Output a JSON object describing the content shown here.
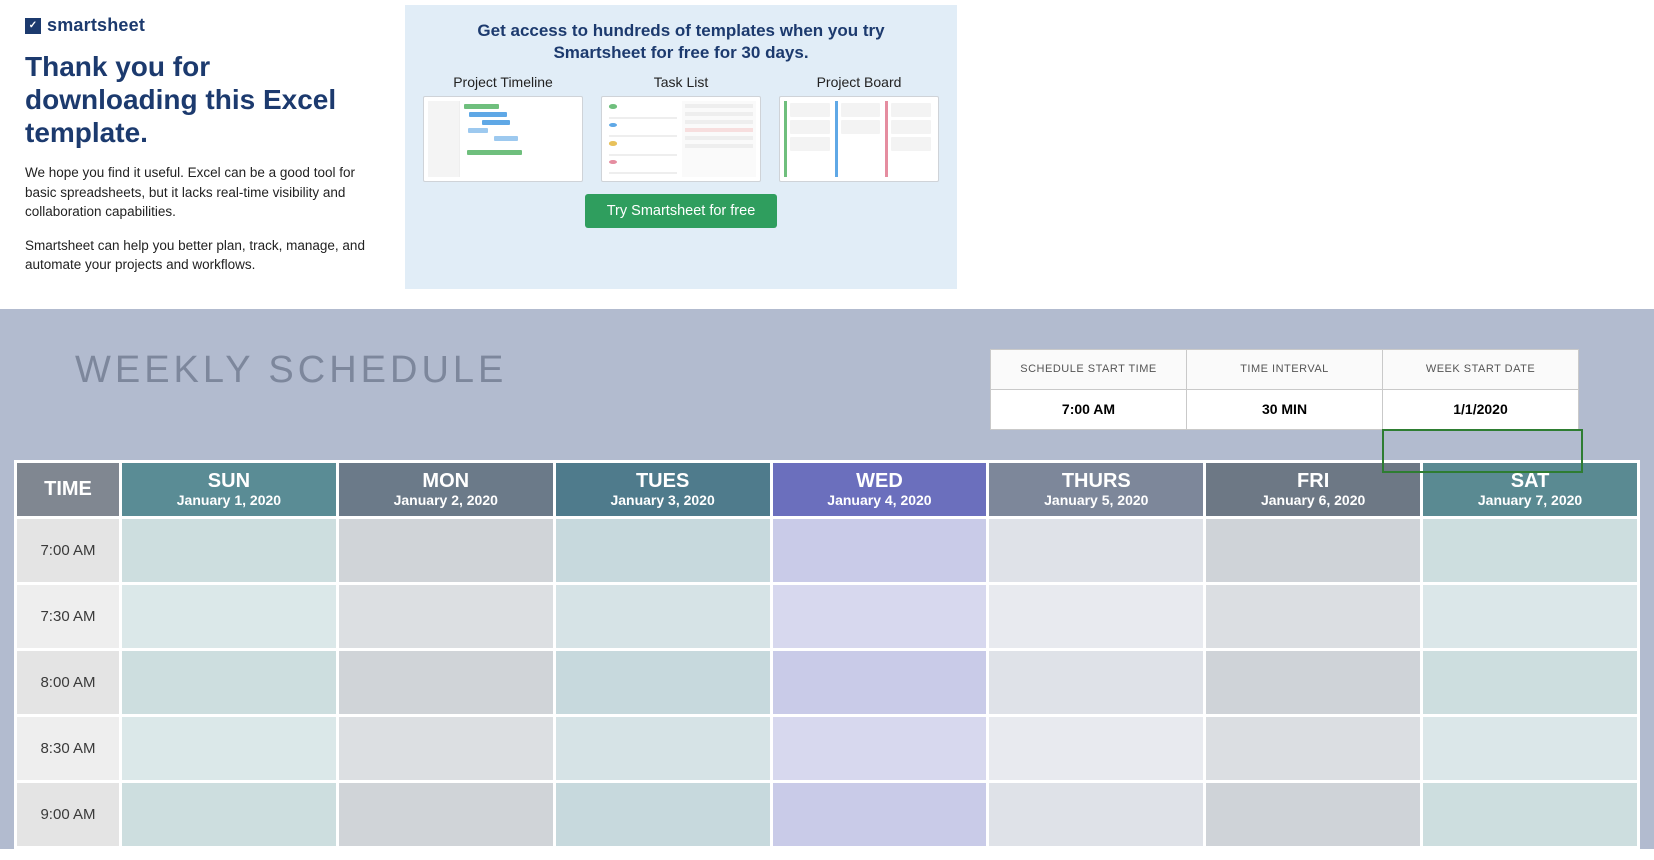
{
  "promo": {
    "logo_text": "smartsheet",
    "heading": "Thank you for downloading this Excel template.",
    "para1": "We hope you find it useful. Excel can be a good tool for basic spreadsheets, but it lacks real-time visibility and collaboration capabilities.",
    "para2": "Smartsheet can help you better plan, track, manage, and automate your projects and workflows.",
    "headline": "Get access to hundreds of templates when you try Smartsheet for free for 30 days.",
    "thumbs": [
      "Project Timeline",
      "Task List",
      "Project Board"
    ],
    "cta": "Try Smartsheet for free"
  },
  "schedule": {
    "title": "WEEKLY SCHEDULE",
    "params": {
      "labels": [
        "SCHEDULE START TIME",
        "TIME INTERVAL",
        "WEEK START DATE"
      ],
      "values": [
        "7:00 AM",
        "30 MIN",
        "1/1/2020"
      ]
    },
    "time_header": "TIME",
    "days": [
      {
        "short": "SUN",
        "date": "January 1, 2020",
        "cls": "sun"
      },
      {
        "short": "MON",
        "date": "January 2, 2020",
        "cls": "mon"
      },
      {
        "short": "TUES",
        "date": "January 3, 2020",
        "cls": "tues"
      },
      {
        "short": "WED",
        "date": "January 4, 2020",
        "cls": "wed"
      },
      {
        "short": "THURS",
        "date": "January 5, 2020",
        "cls": "thurs"
      },
      {
        "short": "FRI",
        "date": "January 6, 2020",
        "cls": "fri"
      },
      {
        "short": "SAT",
        "date": "January 7, 2020",
        "cls": "sat"
      }
    ],
    "times": [
      "7:00 AM",
      "7:30 AM",
      "8:00 AM",
      "8:30 AM",
      "9:00 AM"
    ]
  }
}
